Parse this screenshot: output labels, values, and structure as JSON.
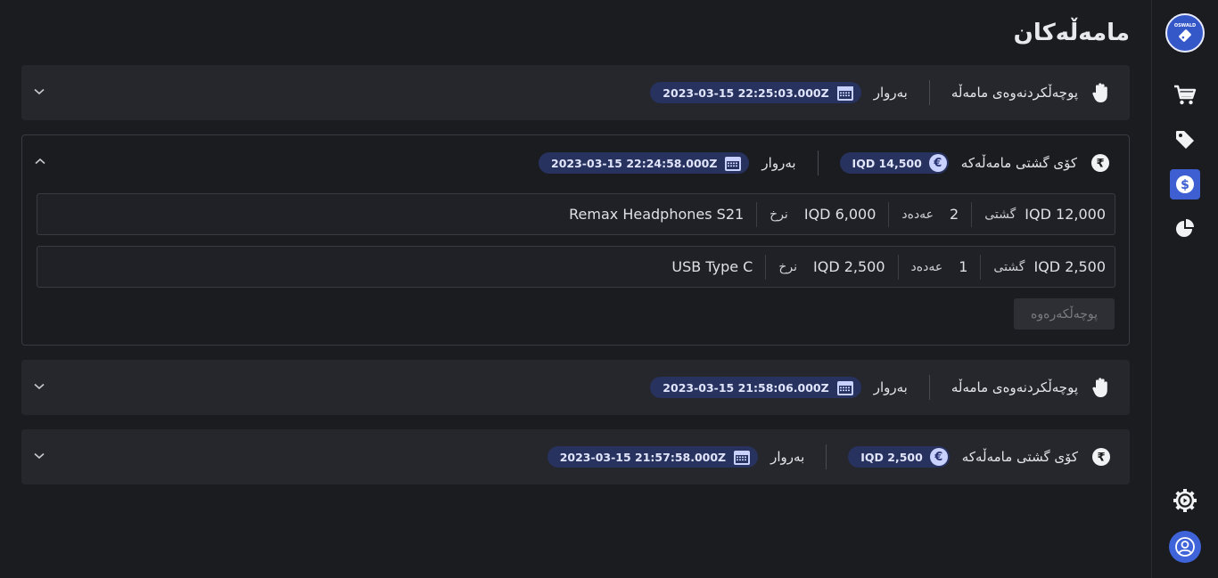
{
  "page_title": "مامەڵەکان",
  "sidebar": {
    "logo_text": "OSWALD",
    "items": [
      {
        "name": "cart-icon"
      },
      {
        "name": "tag-icon"
      },
      {
        "name": "dollar-icon",
        "active": true
      },
      {
        "name": "pie-chart-icon"
      }
    ],
    "settings_icon": "settings-gear-icon",
    "avatar_icon": "user-icon"
  },
  "labels": {
    "date": "بەروار",
    "total": "کۆی گشتی مامەڵەکە",
    "void": "پوچەڵکردنەوەی مامەڵە",
    "item_total": "گشتی",
    "quantity": "عەدەد",
    "rate": "نرخ",
    "cancel_button": "پوچەڵکەرەوە"
  },
  "transactions": [
    {
      "type": "void",
      "date": "2023-03-15 22:25:03.000Z",
      "expanded": false
    },
    {
      "type": "sale",
      "date": "2023-03-15 22:24:58.000Z",
      "amount": "IQD 14,500",
      "expanded": true,
      "items": [
        {
          "total": "IQD 12,000",
          "quantity": "2",
          "rate": "IQD 6,000",
          "name": "Remax Headphones S21"
        },
        {
          "total": "IQD 2,500",
          "quantity": "1",
          "rate": "IQD 2,500",
          "name": "USB Type C"
        }
      ]
    },
    {
      "type": "void",
      "date": "2023-03-15 21:58:06.000Z",
      "expanded": false
    },
    {
      "type": "sale",
      "date": "2023-03-15 21:57:58.000Z",
      "amount": "IQD 2,500",
      "expanded": false
    }
  ],
  "colors": {
    "accent": "#3d5fd1",
    "pill_bg": "#27325e",
    "background": "#1b1c20",
    "card_bg": "#26272d"
  }
}
